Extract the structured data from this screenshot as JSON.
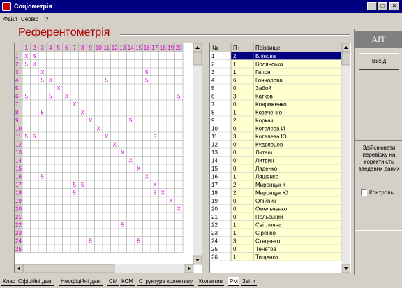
{
  "window": {
    "title": "Соціометрія",
    "minimize": "_",
    "maximize": "□",
    "close": "×"
  },
  "menu": [
    "Файл",
    "Сервіс",
    "?"
  ],
  "page_title": "Референтометрія",
  "matrix": {
    "col_headers": [
      "1",
      "2",
      "3",
      "4",
      "5",
      "6",
      "7",
      "8",
      "9",
      "10",
      "11",
      "12",
      "13",
      "14",
      "15",
      "16",
      "17",
      "18",
      "19",
      "20"
    ],
    "row_headers": [
      "1",
      "2",
      "3",
      "4",
      "5",
      "6",
      "7",
      "8",
      "9",
      "10",
      "11",
      "12",
      "13",
      "14",
      "15",
      "16",
      "17",
      "18",
      "19",
      "20",
      "21",
      "22",
      "23",
      "24",
      "25"
    ],
    "cells": [
      {
        "r": 1,
        "c": 1,
        "v": "X"
      },
      {
        "r": 1,
        "c": 2,
        "v": "5"
      },
      {
        "r": 2,
        "c": 1,
        "v": "5"
      },
      {
        "r": 2,
        "c": 2,
        "v": "X"
      },
      {
        "r": 3,
        "c": 3,
        "v": "X"
      },
      {
        "r": 3,
        "c": 16,
        "v": "5"
      },
      {
        "r": 4,
        "c": 3,
        "v": "5"
      },
      {
        "r": 4,
        "c": 4,
        "v": "X"
      },
      {
        "r": 4,
        "c": 11,
        "v": "5"
      },
      {
        "r": 4,
        "c": 16,
        "v": "5"
      },
      {
        "r": 5,
        "c": 5,
        "v": "X"
      },
      {
        "r": 6,
        "c": 1,
        "v": "5"
      },
      {
        "r": 6,
        "c": 4,
        "v": "5"
      },
      {
        "r": 6,
        "c": 6,
        "v": "X"
      },
      {
        "r": 6,
        "c": 20,
        "v": "5"
      },
      {
        "r": 7,
        "c": 7,
        "v": "X"
      },
      {
        "r": 8,
        "c": 3,
        "v": "5"
      },
      {
        "r": 8,
        "c": 8,
        "v": "X"
      },
      {
        "r": 9,
        "c": 9,
        "v": "X"
      },
      {
        "r": 9,
        "c": 14,
        "v": "5"
      },
      {
        "r": 10,
        "c": 10,
        "v": "X"
      },
      {
        "r": 11,
        "c": 1,
        "v": "5"
      },
      {
        "r": 11,
        "c": 2,
        "v": "5"
      },
      {
        "r": 11,
        "c": 11,
        "v": "X"
      },
      {
        "r": 11,
        "c": 17,
        "v": "5"
      },
      {
        "r": 12,
        "c": 12,
        "v": "X"
      },
      {
        "r": 13,
        "c": 13,
        "v": "X"
      },
      {
        "r": 14,
        "c": 14,
        "v": "X"
      },
      {
        "r": 15,
        "c": 15,
        "v": "X"
      },
      {
        "r": 16,
        "c": 3,
        "v": "5"
      },
      {
        "r": 16,
        "c": 16,
        "v": "X"
      },
      {
        "r": 17,
        "c": 7,
        "v": "5"
      },
      {
        "r": 17,
        "c": 8,
        "v": "5"
      },
      {
        "r": 17,
        "c": 17,
        "v": "X"
      },
      {
        "r": 18,
        "c": 7,
        "v": "5"
      },
      {
        "r": 18,
        "c": 17,
        "v": "5"
      },
      {
        "r": 18,
        "c": 18,
        "v": "X"
      },
      {
        "r": 19,
        "c": 19,
        "v": "X"
      },
      {
        "r": 20,
        "c": 20,
        "v": "X"
      },
      {
        "r": 22,
        "c": 13,
        "v": "5"
      },
      {
        "r": 24,
        "c": 9,
        "v": "5"
      },
      {
        "r": 24,
        "c": 15,
        "v": "5"
      }
    ]
  },
  "list": {
    "headers": [
      "№",
      "R+",
      "Прізвище"
    ],
    "rows": [
      [
        "1",
        "2",
        "Блінова"
      ],
      [
        "2",
        "1",
        "Волянська"
      ],
      [
        "3",
        "1",
        "Гапон"
      ],
      [
        "4",
        "6",
        "Гончарова"
      ],
      [
        "5",
        "0",
        "Забой"
      ],
      [
        "6",
        "3",
        "Катков"
      ],
      [
        "7",
        "0",
        "Ковриженко"
      ],
      [
        "8",
        "1",
        "Козаченко"
      ],
      [
        "9",
        "2",
        "Коркач"
      ],
      [
        "10",
        "0",
        "Котелева И"
      ],
      [
        "11",
        "3",
        "Котелева Ю"
      ],
      [
        "12",
        "0",
        "Кудрявцев"
      ],
      [
        "13",
        "0",
        "Литаш"
      ],
      [
        "14",
        "0",
        "Литвин"
      ],
      [
        "15",
        "0",
        "Ляденко"
      ],
      [
        "16",
        "1",
        "Ляшенко"
      ],
      [
        "17",
        "2",
        "Миронцук К"
      ],
      [
        "18",
        "2",
        "Миронцук Ю"
      ],
      [
        "19",
        "0",
        "Олійник"
      ],
      [
        "20",
        "0",
        "Омельченко"
      ],
      [
        "21",
        "0",
        "Польський"
      ],
      [
        "22",
        "1",
        "Світлична"
      ],
      [
        "23",
        "1",
        "Сіренко"
      ],
      [
        "24",
        "3",
        "Стеценко"
      ],
      [
        "25",
        "0",
        "Тенетов"
      ],
      [
        "26",
        "1",
        "Тищенко"
      ]
    ]
  },
  "right": {
    "ait": "AIT",
    "exit": "Вихід",
    "check_button": "Здійснювати перевірку на коректність введених даних",
    "control_label": "Контроль"
  },
  "tabs": [
    "Клас",
    "Офіційні дані",
    "Неофіційні дані",
    "СМ",
    "КСМ",
    "Структура колективу",
    "Колектив",
    "РМ",
    "Звіти"
  ],
  "active_tab": "РМ",
  "colors": {
    "titlebar": "#000080",
    "accent_red": "#b00000",
    "magenta": "#cc00cc",
    "yellow_cell": "#ffffd0",
    "selected": "#000080"
  }
}
